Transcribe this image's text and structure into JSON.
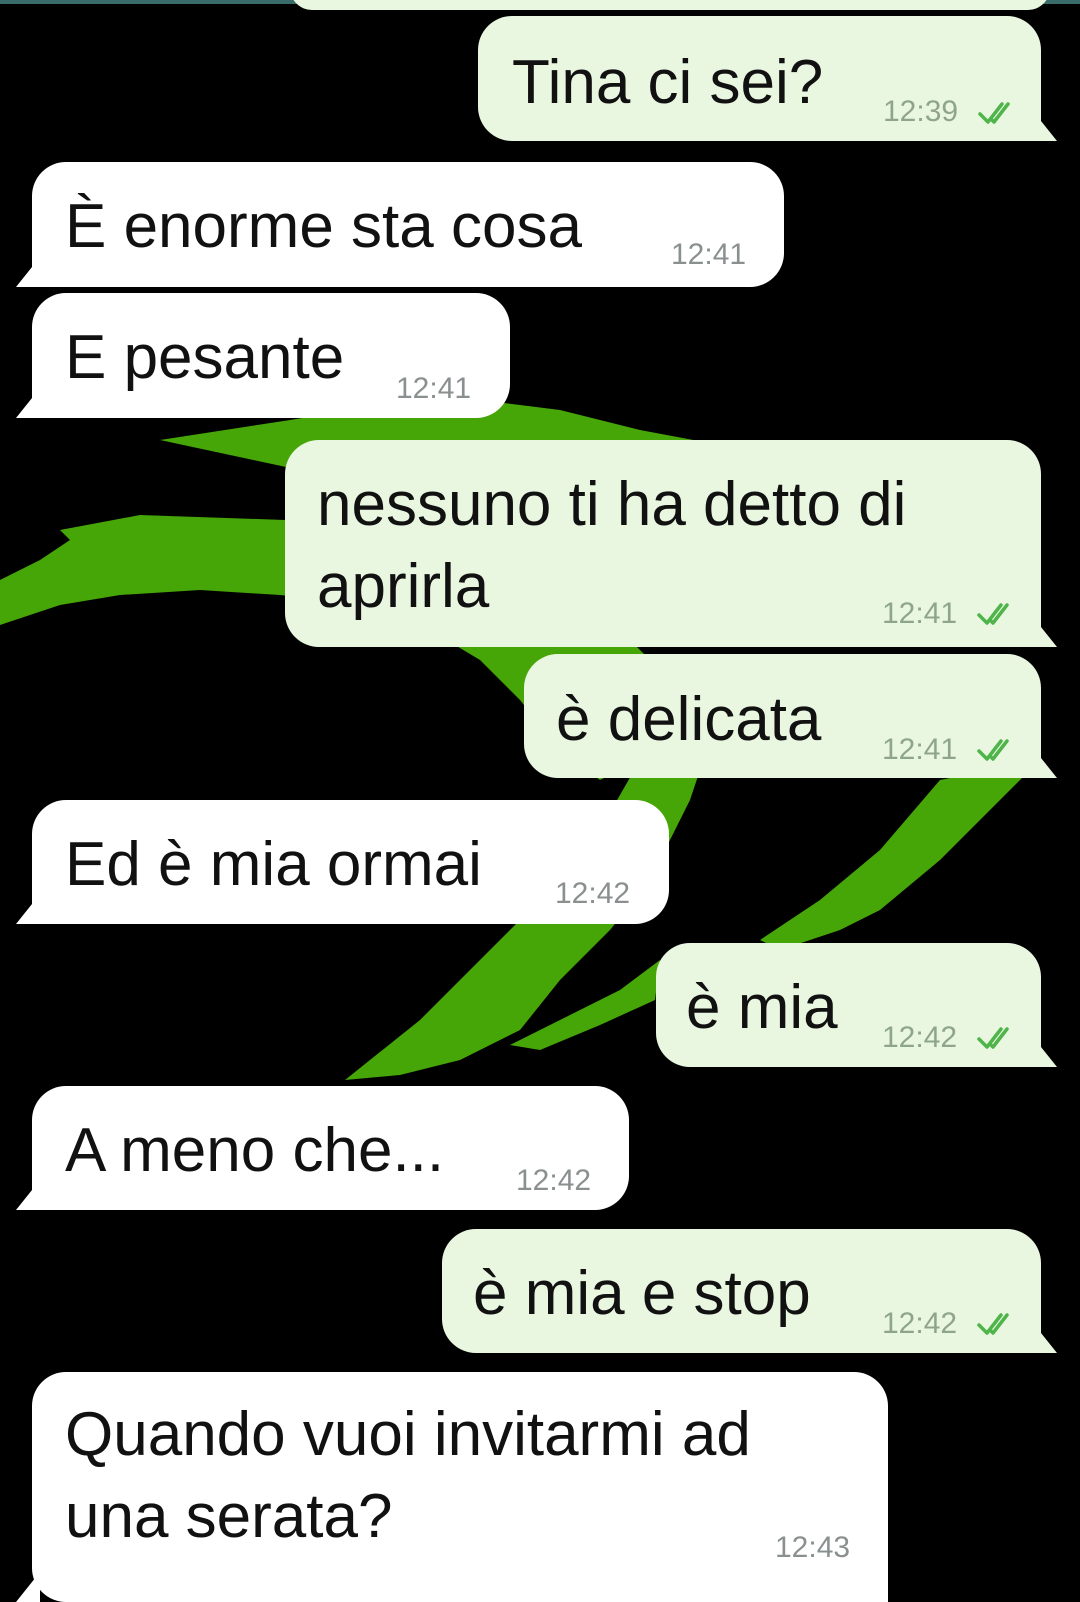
{
  "theme": {
    "background": "#000000",
    "wallpaper_accent": "#46a608",
    "incoming_bubble": "#ffffff",
    "outgoing_bubble": "#e9f7e1",
    "tick_color": "#4fb54a"
  },
  "messages": [
    {
      "direction": "out",
      "text": "Tina ci sei?",
      "time": "12:39",
      "read": true
    },
    {
      "direction": "in",
      "text": "È enorme sta cosa",
      "time": "12:41"
    },
    {
      "direction": "in",
      "text": "E pesante",
      "time": "12:41"
    },
    {
      "direction": "out",
      "text": "nessuno ti ha detto di\naprirla",
      "time": "12:41",
      "read": true
    },
    {
      "direction": "out",
      "text": "è delicata",
      "time": "12:41",
      "read": true
    },
    {
      "direction": "in",
      "text": "Ed è mia ormai",
      "time": "12:42"
    },
    {
      "direction": "out",
      "text": "è mia",
      "time": "12:42",
      "read": true
    },
    {
      "direction": "in",
      "text": "A meno che...",
      "time": "12:42"
    },
    {
      "direction": "out",
      "text": "è mia e stop",
      "time": "12:42",
      "read": true
    },
    {
      "direction": "in",
      "text": "Quando vuoi invitarmi ad\nuna serata?",
      "time": "12:43"
    }
  ],
  "icons": {
    "read_receipt": "double-check-icon"
  }
}
